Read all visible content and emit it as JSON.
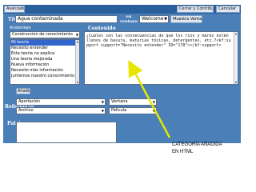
{
  "topbar": {
    "avanzado": "Avanzado",
    "cerrar_contribuir": "Cerrar y Contribuir",
    "cancelar": "Cancelar"
  },
  "title_row": {
    "label": "Título",
    "value": "Agua contaminada",
    "en_ventana": "en ventana",
    "window_select": "Welcome",
    "muestra_button": "Muestra Ventana"
  },
  "andamiaje": {
    "label": "Andamiaje",
    "category_select": "Construccion de conocimiento",
    "items": [
      "Mi teoría",
      "Necesito entender",
      "Esta teoría no explica",
      "Una teoría mejorada",
      "Nueva información",
      "Necesito más información",
      "Juntemos nuestro conocimiento"
    ],
    "selected_index": 0,
    "add_button": "Añadir"
  },
  "contenido": {
    "label": "Contenido",
    "text": "¿Cuáles son las consecuencias de que los ríos y mares estén llenos de basura, materias tóxicas, detergentes, etc.?<kf:support support=\"Necesito entender\" ID=\"178\"></kf:support>"
  },
  "referencia": {
    "label": "Referencia",
    "aportacion": "Aportación",
    "ventana": "Ventana",
    "archivo": "Archivo",
    "pelicula": "Pelicula"
  },
  "palabras": {
    "label": "Palabras"
  },
  "annotation": {
    "line1": "CATEGORÍA AÑADIDA",
    "line2": "EN HTML",
    "arrow_color": "#e6e600"
  },
  "colors": {
    "window_bg": "#4a7fb8",
    "topbar_bg": "#2a5f9e",
    "selection": "#3366cc"
  }
}
